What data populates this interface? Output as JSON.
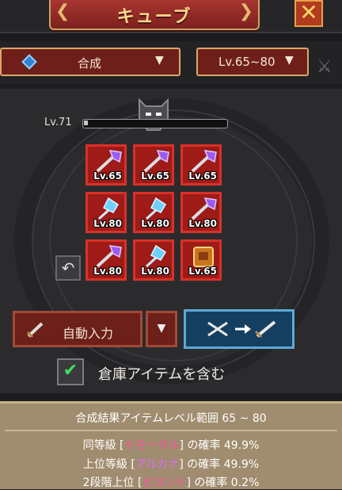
{
  "header": {
    "title": "キューブ",
    "close_icon": "close-x-icon"
  },
  "selectors": {
    "mode": {
      "label": "合成",
      "icon": "blue-gem-icon"
    },
    "level_range": {
      "label": "Lv.65~80"
    }
  },
  "cube": {
    "level_label": "Lv.71",
    "level_progress": 0.03,
    "undo_icon": "undo-arrow-icon"
  },
  "slots": [
    {
      "lv": "Lv.65",
      "icon": "purple-axe-icon"
    },
    {
      "lv": "Lv.65",
      "icon": "purple-axe-icon"
    },
    {
      "lv": "Lv.65",
      "icon": "purple-axe-icon"
    },
    {
      "lv": "Lv.80",
      "icon": "blue-crystal-icon"
    },
    {
      "lv": "Lv.80",
      "icon": "blue-crystal-icon"
    },
    {
      "lv": "Lv.80",
      "icon": "purple-axe-icon"
    },
    {
      "lv": "Lv.80",
      "icon": "purple-axe-icon"
    },
    {
      "lv": "Lv.80",
      "icon": "blue-crystal-icon"
    },
    {
      "lv": "Lv.65",
      "icon": "gold-armor-icon"
    }
  ],
  "buttons": {
    "auto_fill": "自動入力",
    "combine_icon": "combine-icon"
  },
  "checkbox": {
    "label": "倉庫アイテムを含む",
    "checked": true
  },
  "info": {
    "heading": "合成結果アイテムレベル範囲 65 ~ 80",
    "lines": [
      {
        "prefix": "同等級 [",
        "grade": "イモータル",
        "suffix": "] の確率 49.9%"
      },
      {
        "prefix": "上位等級 [",
        "grade": "アルカナ",
        "suffix": "] の確率 49.9%"
      },
      {
        "prefix": "2段階上位 [",
        "grade": "ビヨンド",
        "suffix": "] の確率 0.2%"
      }
    ]
  },
  "colors": {
    "slot_red": "#9e1b18",
    "combine_blue": "#153f60",
    "grade_pink": "#ff4fa3"
  }
}
